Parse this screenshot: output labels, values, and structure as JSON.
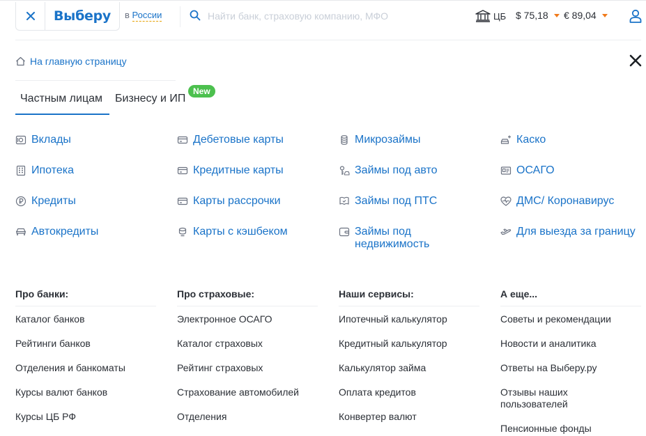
{
  "header": {
    "logo": "Выберу",
    "region_prefix": "в",
    "region": "России",
    "search_placeholder": "Найти банк, страховую компанию, МФО",
    "cb_label": "ЦБ",
    "usd": "$ 75,18",
    "eur": "€ 89,04"
  },
  "home_link": "На главную страницу",
  "tabs": [
    {
      "label": "Частным лицам",
      "active": true
    },
    {
      "label": "Бизнесу и ИП",
      "badge": "New"
    }
  ],
  "products": [
    [
      "Вклады",
      "Ипотека",
      "Кредиты",
      "Автокредиты"
    ],
    [
      "Дебетовые карты",
      "Кредитные карты",
      "Карты рассрочки",
      "Карты с кэшбеком"
    ],
    [
      "Микрозаймы",
      "Займы под авто",
      "Займы под ПТС",
      "Займы под недвижимость"
    ],
    [
      "Каско",
      "ОСАГО",
      "ДМС/ Коронавирус",
      "Для выезда за границу"
    ]
  ],
  "columns": [
    {
      "title": "Про банки:",
      "items": [
        "Каталог банков",
        "Рейтинги банков",
        "Отделения и банкоматы",
        "Курсы валют банков",
        "Курсы ЦБ РФ"
      ]
    },
    {
      "title": "Про страховые:",
      "items": [
        "Электронное ОСАГО",
        "Каталог страховых",
        "Рейтинг страховых",
        "Страхование автомобилей",
        "Отделения"
      ]
    },
    {
      "title": "Наши сервисы:",
      "items": [
        "Ипотечный калькулятор",
        "Кредитный калькулятор",
        "Калькулятор займа",
        "Оплата кредитов",
        "Конвертер валют"
      ]
    },
    {
      "title": "А еще...",
      "items": [
        "Советы и рекомендации",
        "Новости и аналитика",
        "Ответы на Выберу.ру",
        "Отзывы наших пользователей",
        "Пенсионные фонды"
      ]
    }
  ],
  "colors": {
    "brand": "#1a73c8",
    "accent": "#f07a1b",
    "badge": "#4cc04e"
  }
}
